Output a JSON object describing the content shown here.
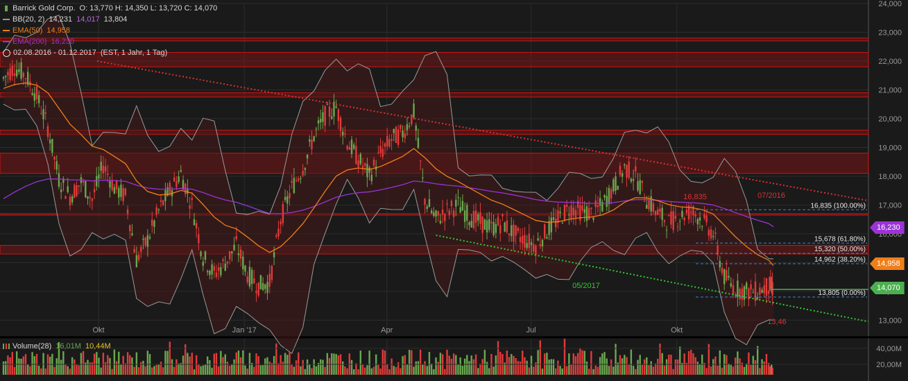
{
  "legend": {
    "symbol": "Barrick Gold Corp.",
    "ohlc": "O: 13,770  H: 14,350  L: 13,720  C: 14,070",
    "bb_label": "BB(20, 2)",
    "bb_values": [
      "14,231",
      "14,017",
      "13,804"
    ],
    "ema50_label": "EMA(50)",
    "ema50_value": "14,958",
    "ema200_label": "EMA(200)",
    "ema200_value": "16,230",
    "range": "02.08.2016 - 01.12.2017",
    "range_info": "(EST, 1 Jahr, 1 Tag)"
  },
  "volume_legend": {
    "label": "Volume(28)",
    "v1": "16,01M",
    "v2": "10,44M"
  },
  "price_badges": {
    "ema200": "16,230",
    "ema50": "14,958",
    "close": "14,070"
  },
  "colors": {
    "background": "#1a1a1a",
    "up": "#6aa84f",
    "down": "#e03b3b",
    "bb": "#9a9a9a",
    "ema50": "#f07f1a",
    "ema200": "#9b33d6",
    "resistance": "#d01515",
    "downtrend": "#e03030",
    "support_trend": "#2ecc2e",
    "fib": "#3a86d6",
    "badge_ema200": "#9b33d6",
    "badge_ema50": "#f07f1a",
    "badge_close": "#4caf50"
  },
  "chart_data": {
    "type": "candlestick",
    "title": "Barrick Gold Corp.",
    "period": "02.08.2016 - 01.12.2017",
    "y_axis": {
      "ticks": [
        "13,000",
        "14,000",
        "15,000",
        "16,000",
        "17,000",
        "18,000",
        "19,000",
        "20,000",
        "21,000",
        "22,000",
        "23,000",
        "24,000"
      ],
      "min": 12.6,
      "max": 24.0
    },
    "x_axis": {
      "ticks": [
        "Okt",
        "Jan '17",
        "Apr",
        "Jul",
        "Okt"
      ]
    },
    "volume_axis": {
      "ticks": [
        "40,00M",
        "20,00M"
      ]
    },
    "series": [
      {
        "name": "Close",
        "points": [
          [
            "2016-08-02",
            21.4
          ],
          [
            "2016-08-09",
            21.8
          ],
          [
            "2016-08-16",
            21.5
          ],
          [
            "2016-08-23",
            20.8
          ],
          [
            "2016-08-30",
            19.7
          ],
          [
            "2016-09-06",
            17.9
          ],
          [
            "2016-09-13",
            17.3
          ],
          [
            "2016-09-20",
            17.8
          ],
          [
            "2016-09-27",
            17.2
          ],
          [
            "2016-10-04",
            18.4
          ],
          [
            "2016-10-11",
            17.6
          ],
          [
            "2016-10-18",
            17.3
          ],
          [
            "2016-10-25",
            15.1
          ],
          [
            "2016-11-01",
            15.8
          ],
          [
            "2016-11-08",
            16.8
          ],
          [
            "2016-11-15",
            17.5
          ],
          [
            "2016-11-22",
            18.1
          ],
          [
            "2016-11-29",
            17.0
          ],
          [
            "2016-12-06",
            15.2
          ],
          [
            "2016-12-13",
            14.6
          ],
          [
            "2016-12-20",
            15.0
          ],
          [
            "2016-12-27",
            15.6
          ],
          [
            "2017-01-03",
            14.6
          ],
          [
            "2017-01-10",
            14.2
          ],
          [
            "2017-01-17",
            14.3
          ],
          [
            "2017-01-24",
            16.5
          ],
          [
            "2017-01-31",
            17.6
          ],
          [
            "2017-02-07",
            18.3
          ],
          [
            "2017-02-14",
            19.4
          ],
          [
            "2017-02-21",
            20.1
          ],
          [
            "2017-02-28",
            20.4
          ],
          [
            "2017-03-07",
            19.2
          ],
          [
            "2017-03-14",
            18.6
          ],
          [
            "2017-03-21",
            18.0
          ],
          [
            "2017-03-28",
            18.8
          ],
          [
            "2017-04-04",
            19.3
          ],
          [
            "2017-04-11",
            19.5
          ],
          [
            "2017-04-18",
            20.2
          ],
          [
            "2017-04-25",
            17.2
          ],
          [
            "2017-05-02",
            16.5
          ],
          [
            "2017-05-09",
            16.8
          ],
          [
            "2017-05-16",
            17.0
          ],
          [
            "2017-05-23",
            16.6
          ],
          [
            "2017-05-30",
            16.4
          ],
          [
            "2017-06-06",
            16.2
          ],
          [
            "2017-06-13",
            16.4
          ],
          [
            "2017-06-20",
            16.0
          ],
          [
            "2017-06-27",
            15.8
          ],
          [
            "2017-07-04",
            15.6
          ],
          [
            "2017-07-11",
            16.1
          ],
          [
            "2017-07-18",
            16.5
          ],
          [
            "2017-07-25",
            16.9
          ],
          [
            "2017-08-01",
            16.8
          ],
          [
            "2017-08-08",
            16.7
          ],
          [
            "2017-08-15",
            17.0
          ],
          [
            "2017-08-22",
            17.6
          ],
          [
            "2017-08-29",
            18.3
          ],
          [
            "2017-09-05",
            18.0
          ],
          [
            "2017-09-12",
            17.2
          ],
          [
            "2017-09-19",
            16.7
          ],
          [
            "2017-09-26",
            16.4
          ],
          [
            "2017-10-03",
            16.6
          ],
          [
            "2017-10-10",
            16.8
          ],
          [
            "2017-10-17",
            16.5
          ],
          [
            "2017-10-24",
            16.0
          ],
          [
            "2017-10-31",
            14.5
          ],
          [
            "2017-11-07",
            14.1
          ],
          [
            "2017-11-14",
            14.0
          ],
          [
            "2017-11-21",
            14.0
          ],
          [
            "2017-11-28",
            14.2
          ],
          [
            "2017-12-01",
            14.07
          ]
        ]
      },
      {
        "name": "EMA(50)",
        "last": 14.958
      },
      {
        "name": "EMA(200)",
        "last": 16.23
      },
      {
        "name": "BB(20, 2)",
        "upper": 14.231,
        "middle": 14.017,
        "lower": 13.804
      }
    ],
    "resistance_zones": [
      [
        22.7,
        22.8
      ],
      [
        21.8,
        22.3
      ],
      [
        20.75,
        20.9
      ],
      [
        19.45,
        19.6
      ],
      [
        18.1,
        18.8
      ],
      [
        16.65,
        16.7
      ],
      [
        15.3,
        15.6
      ]
    ],
    "fibonacci": [
      {
        "label": "16,835 (100.00%)",
        "value": 16.835
      },
      {
        "label": "15,678 (61.80%)",
        "value": 15.678
      },
      {
        "label": "15,320 (50.00%)",
        "value": 15.32
      },
      {
        "label": "14,962 (38.20%)",
        "value": 14.962
      },
      {
        "label": "13,805 (0.00%)",
        "value": 13.805
      }
    ],
    "annotations": [
      {
        "text": "16,835",
        "value": 16.835
      },
      {
        "text": "07/2016"
      },
      {
        "text": "05/2017"
      },
      {
        "text": "13,46",
        "value": 13.46
      }
    ]
  }
}
